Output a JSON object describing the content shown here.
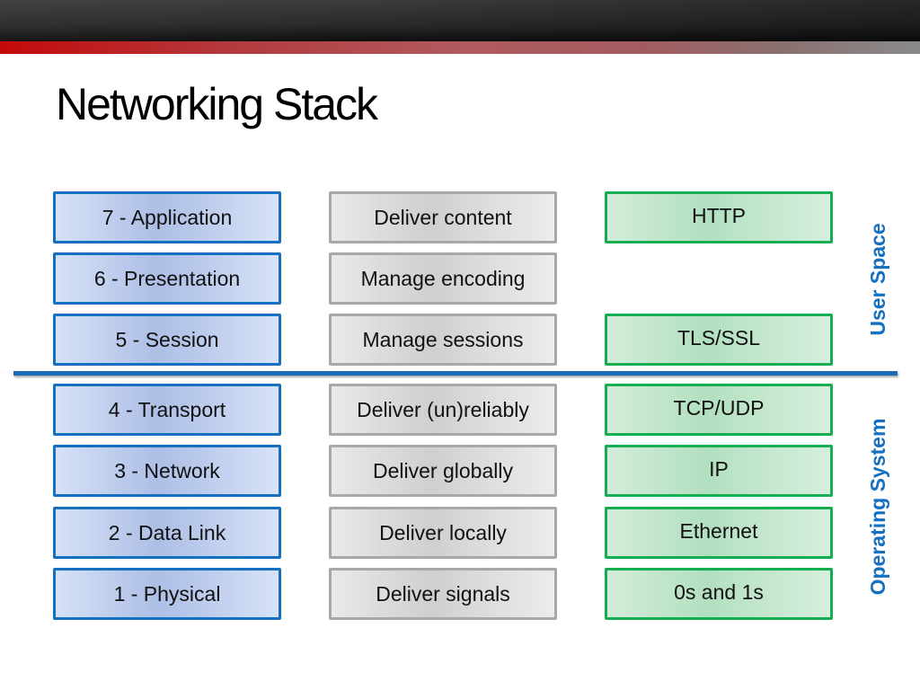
{
  "slide": {
    "title": "Networking Stack",
    "colors": {
      "layer_border": "#1570bf",
      "desc_border": "#a8a8a8",
      "proto_border": "#13ad52",
      "divider": "#1b6db7",
      "side_label": "#1570bf",
      "accent_bar_start": "#c40a0a",
      "accent_bar_end": "#8a8a8a"
    }
  },
  "rows": [
    {
      "layer": "7 - Application",
      "role": "Deliver content",
      "protocol": "HTTP"
    },
    {
      "layer": "6 - Presentation",
      "role": "Manage encoding",
      "protocol": ""
    },
    {
      "layer": "5 - Session",
      "role": "Manage sessions",
      "protocol": "TLS/SSL"
    },
    {
      "layer": "4 - Transport",
      "role": "Deliver (un)reliably",
      "protocol": "TCP/UDP"
    },
    {
      "layer": "3 - Network",
      "role": "Deliver globally",
      "protocol": "IP"
    },
    {
      "layer": "2 - Data Link",
      "role": "Deliver locally",
      "protocol": "Ethernet"
    },
    {
      "layer": "1 - Physical",
      "role": "Deliver signals",
      "protocol": "0s and 1s"
    }
  ],
  "regions": {
    "upper": "User Space",
    "lower": "Operating System"
  }
}
